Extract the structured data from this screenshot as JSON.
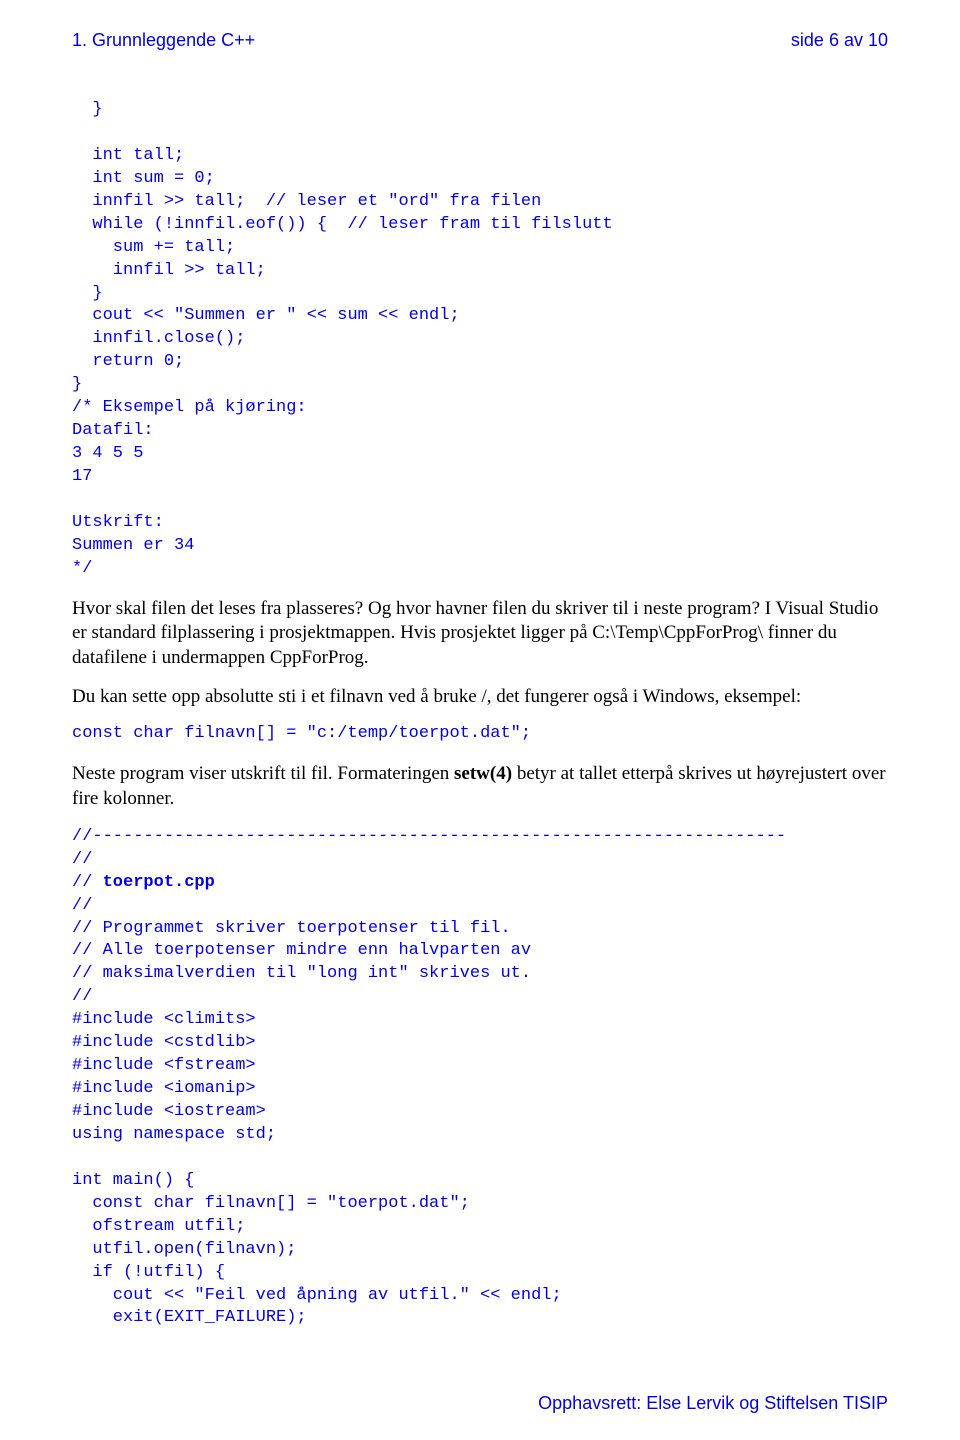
{
  "header": {
    "left": "1. Grunnleggende C++",
    "right": "side 6 av 10"
  },
  "code_block_1": "  }\n\n  int tall;\n  int sum = 0;\n  innfil >> tall;  // leser et \"ord\" fra filen\n  while (!innfil.eof()) {  // leser fram til filslutt\n    sum += tall;\n    innfil >> tall;\n  }\n  cout << \"Summen er \" << sum << endl;\n  innfil.close();\n  return 0;\n}\n/* Eksempel på kjøring:\nDatafil:\n3 4 5 5\n17\n\nUtskrift:\nSummen er 34\n*/",
  "para1": "Hvor skal filen det leses fra plasseres? Og hvor havner filen du skriver til i neste program? I Visual Studio er standard filplassering i prosjektmappen. Hvis prosjektet ligger på C:\\Temp\\CppForProg\\ finner du datafilene i undermappen CppForProg.",
  "para2": "Du kan sette opp absolutte sti i et filnavn ved å bruke /, det fungerer også i Windows, eksempel:",
  "code_block_2": "const char filnavn[] = \"c:/temp/toerpot.dat\";",
  "para3_a": "Neste program viser utskrift til fil. Formateringen ",
  "para3_bold": "setw(4)",
  "para3_b": " betyr at tallet etterpå skrives ut høyrejustert over fire kolonner.",
  "code_block_3a": "//--------------------------------------------------------------------\n//\n// ",
  "code_block_3_bold": "toerpot.cpp",
  "code_block_3b": "\n//\n// Programmet skriver toerpotenser til fil.\n// Alle toerpotenser mindre enn halvparten av\n// maksimalverdien til \"long int\" skrives ut.\n//\n#include <climits>\n#include <cstdlib>\n#include <fstream>\n#include <iomanip>\n#include <iostream>\nusing namespace std;\n\nint main() {\n  const char filnavn[] = \"toerpot.dat\";\n  ofstream utfil;\n  utfil.open(filnavn);\n  if (!utfil) {\n    cout << \"Feil ved åpning av utfil.\" << endl;\n    exit(EXIT_FAILURE);",
  "footer": "Opphavsrett: Else Lervik og Stiftelsen TISIP"
}
